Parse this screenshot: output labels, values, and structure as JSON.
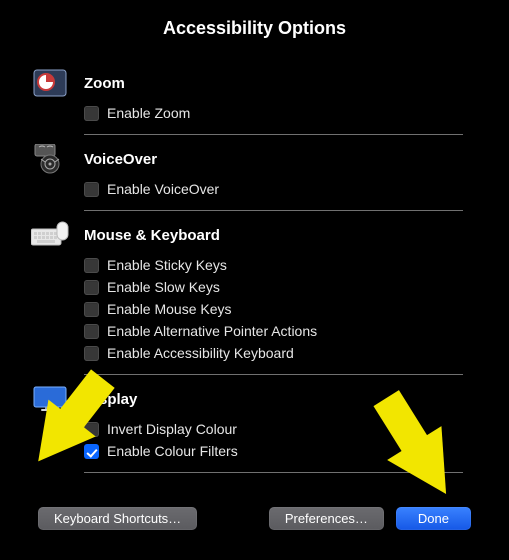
{
  "title": "Accessibility Options",
  "sections": {
    "zoom": {
      "title": "Zoom",
      "options": [
        {
          "label": "Enable Zoom",
          "checked": false
        }
      ]
    },
    "voiceover": {
      "title": "VoiceOver",
      "options": [
        {
          "label": "Enable VoiceOver",
          "checked": false
        }
      ]
    },
    "mouse_keyboard": {
      "title": "Mouse & Keyboard",
      "options": [
        {
          "label": "Enable Sticky Keys",
          "checked": false
        },
        {
          "label": "Enable Slow Keys",
          "checked": false
        },
        {
          "label": "Enable Mouse Keys",
          "checked": false
        },
        {
          "label": "Enable Alternative Pointer Actions",
          "checked": false
        },
        {
          "label": "Enable Accessibility Keyboard",
          "checked": false
        }
      ]
    },
    "display": {
      "title": "Display",
      "options": [
        {
          "label": "Invert Display Colour",
          "checked": false
        },
        {
          "label": "Enable Colour Filters",
          "checked": true
        }
      ]
    }
  },
  "buttons": {
    "shortcuts": "Keyboard Shortcuts…",
    "preferences": "Preferences…",
    "done": "Done"
  }
}
